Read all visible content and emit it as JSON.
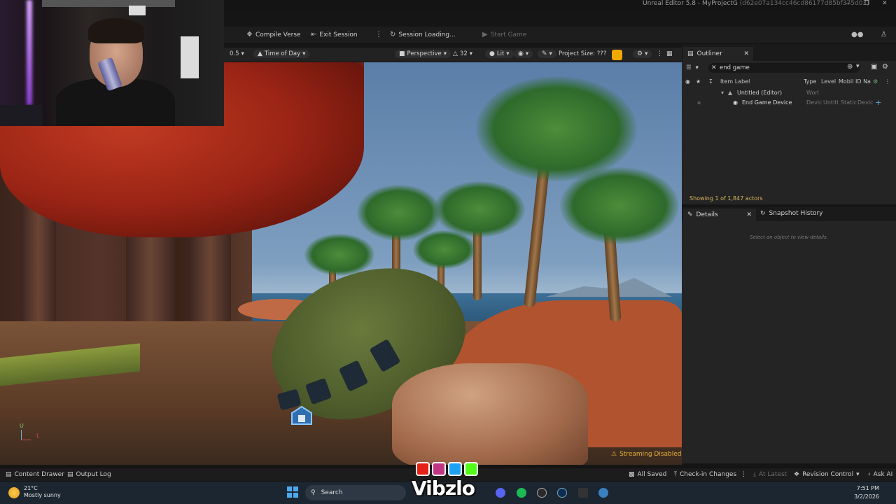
{
  "window": {
    "title": "Unreal Editor 5.8 - MyProjectG",
    "hash": "(d62e07a134cc46cd86177d85bf375d03)"
  },
  "toolbar": {
    "compile_verse": "Compile Verse",
    "exit_session": "Exit Session",
    "session_status": "Session Loading...",
    "start_game": "Start Game"
  },
  "viewport_toolbar": {
    "speed": "0.5",
    "time_of_day": "Time of Day",
    "perspective": "Perspective",
    "fov": "32",
    "lit": "Lit",
    "project_size": "Project Size: ???"
  },
  "viewport": {
    "streaming": "Streaming Disabled",
    "axis_u": "U",
    "axis_l": "L"
  },
  "outliner": {
    "tab": "Outliner",
    "search_value": "end game",
    "columns": [
      "Item Label",
      "Type",
      "Level",
      "Mobil",
      "ID Na"
    ],
    "rows": [
      {
        "label": "Untitled (Editor)",
        "type": "Worl",
        "level": "",
        "mobil": "",
        "id": ""
      },
      {
        "label": "End Game Device",
        "type": "Devic",
        "level": "Untitl",
        "mobil": "Static",
        "id": "Devic"
      }
    ],
    "status": "Showing 1 of 1,847 actors"
  },
  "details": {
    "tab": "Details",
    "tab2": "Snapshot History",
    "hint": "Select an object to view details."
  },
  "bottom_bar": {
    "content_drawer": "Content Drawer",
    "output_log": "Output Log",
    "all_saved": "All Saved",
    "check_in": "Check-in Changes",
    "at_latest": "At Latest",
    "revision_control": "Revision Control",
    "ask_ai": "Ask AI"
  },
  "taskbar": {
    "temp": "21°C",
    "weather": "Mostly sunny",
    "search": "Search",
    "time": "7:51 PM",
    "date": "3/2/2026"
  },
  "brand": {
    "name": "Vibzlo"
  },
  "colors": {
    "accent": "#f2a900",
    "status_text": "#d8b65a"
  }
}
